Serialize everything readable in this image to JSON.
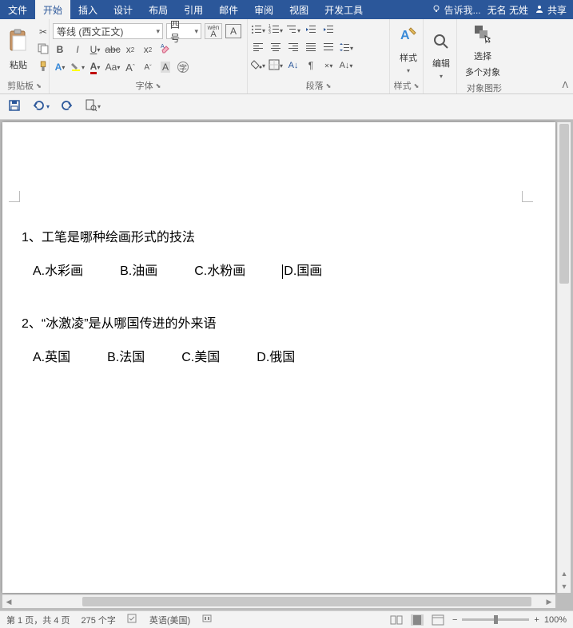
{
  "tabs": {
    "file": "文件",
    "home": "开始",
    "insert": "插入",
    "design": "设计",
    "layout": "布局",
    "references": "引用",
    "mailings": "邮件",
    "review": "审阅",
    "view": "视图",
    "devtools": "开发工具"
  },
  "header": {
    "tell": "告诉我...",
    "user": "无名 无姓",
    "share": "共享"
  },
  "ribbon": {
    "clipboard": {
      "paste": "粘贴",
      "label": "剪贴板"
    },
    "font": {
      "name": "等线 (西文正文)",
      "size": "四号",
      "label": "字体",
      "wen": "wén",
      "boxA": "A"
    },
    "paragraph": {
      "label": "段落"
    },
    "styles": {
      "btn": "样式",
      "label": "样式"
    },
    "editing": {
      "btn": "编辑"
    },
    "select": {
      "l1": "选择",
      "l2": "多个对象",
      "label": "对象图形"
    }
  },
  "doc": {
    "q1": "1、工笔是哪种绘画形式的技法",
    "q1a": "A.水彩画",
    "q1b": "B.油画",
    "q1c": "C.水粉画",
    "q1d": "D.国画",
    "q2": "2、“冰激凌”是从哪国传进的外来语",
    "q2a": "A.英国",
    "q2b": "B.法国",
    "q2c": "C.美国",
    "q2d": "D.俄国"
  },
  "status": {
    "pages": "第 1 页，共 4 页",
    "words": "275 个字",
    "lang": "英语(美国)",
    "zoom": "100%",
    "minus": "−",
    "plus": "+"
  }
}
